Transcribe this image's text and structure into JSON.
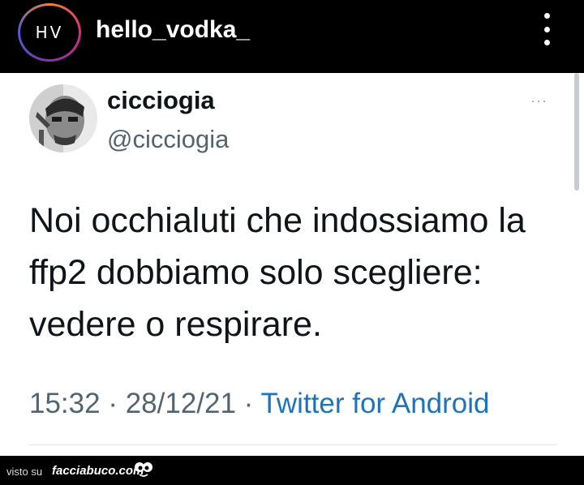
{
  "instagram": {
    "avatar_initials": "HV",
    "username": "hello_vodka_",
    "more_icon": "vertical-dots-icon"
  },
  "tweet": {
    "display_name": "cicciogia",
    "handle": "@cicciogia",
    "menu_glyph": "···",
    "text": "Noi occhialuti che indossiamo la ffp2 dobbiamo solo scegliere: vedere o respirare.",
    "time": "15:32",
    "separator": " · ",
    "date": "28/12/21",
    "source": "Twitter for Android",
    "source_color": "#1d73bd"
  },
  "watermark": {
    "prefix": "visto su",
    "site": "facciabuco.com",
    "icon": "googly-eyes-icon"
  }
}
